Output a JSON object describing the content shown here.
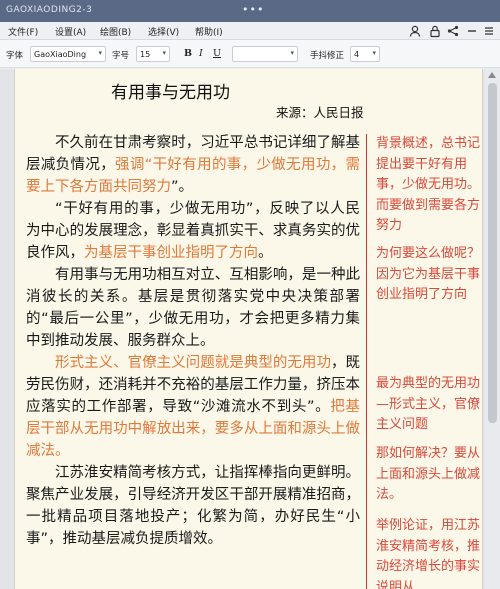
{
  "window": {
    "title": "GAOXIAODING2-3",
    "more_label": "•••"
  },
  "menu": {
    "items": [
      "文件(F)",
      "设置(A)",
      "绘图(B)",
      "选择(V)",
      "帮助(I)"
    ],
    "icons": [
      "user-icon",
      "lock-icon",
      "share-icon",
      "minus-icon",
      "list-icon"
    ]
  },
  "toolbar": {
    "font_label": "字体",
    "font_value": "GaoXiaoDing",
    "size_label": "字号",
    "size_value": "15",
    "bold": "B",
    "italic": "I",
    "underline": "U",
    "color_value": "",
    "handwrite_label": "手抖修正",
    "handwrite_value": "4"
  },
  "document": {
    "title": "有用事与无用功",
    "source": "来源：人民日报",
    "paragraphs": [
      [
        {
          "t": "不久前在甘肃考察时，习近平总书记详细了解基层减负情况，"
        },
        {
          "t": "强调“干好有用的事，少做无用功，需要上下各方面共同努力",
          "h": true
        },
        {
          "t": "”。"
        }
      ],
      [
        {
          "t": "“干好有用的事，少做无用功”，反映了以人民为中心的发展理念，彰显着真抓实干、求真务实的优良作风，"
        },
        {
          "t": "为基层干事创业指明了方向",
          "h": true
        },
        {
          "t": "。"
        }
      ],
      [
        {
          "t": "有用事与无用功相互对立、互相影响，是一种此消彼长的关系。基层是贯彻落实党中央决策部署的“最后一公里”，少做无用功，才会把更多精力集中到推动发展、服务群众上。"
        }
      ],
      [
        {
          "t": "形式主义、官僚主义问题就是典型的无用功",
          "h": true
        },
        {
          "t": "，既劳民伤财，还消耗并不充裕的基层工作力量，挤压本应落实的工作部署，导致“沙滩流水不到头”。"
        },
        {
          "t": "把基层干部从无用功中解放出来，要多从上面和源头上做减法。",
          "h": true
        }
      ],
      [
        {
          "t": "江苏淮安精简考核方式，让指挥棒指向更鲜明。聚焦产业发展，引导经济开发区干部开展精准招商，一批精品项目落地投产；化繁为简，办好民生“小事”，推动基层减负提质增效。"
        }
      ]
    ]
  },
  "notes": [
    "背景概述，总书记提出要干好有用事，少做无用功。而要做到需要各方努力",
    "为何要这么做呢？因为它为基层干事创业指明了方向",
    "最为典型的无用功—形式主义，官僚主义问题",
    "那如何解决？要从上面和源头上做减法。",
    "举例论证，用江苏淮安精简考核，推动经济增长的事实说明从"
  ]
}
